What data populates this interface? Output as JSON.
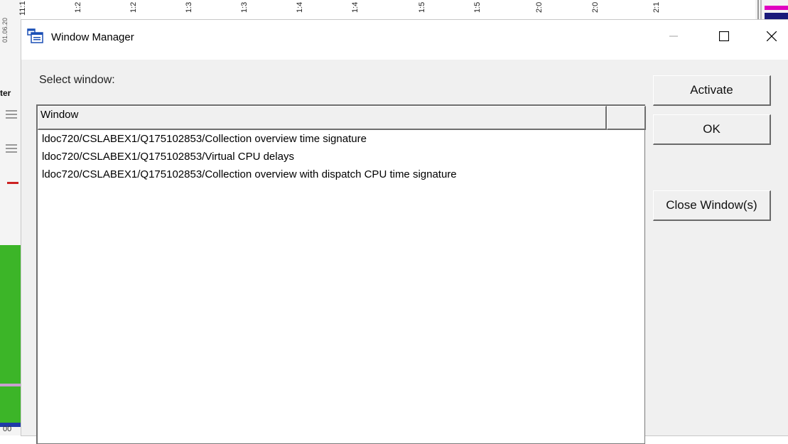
{
  "background": {
    "top_ticks": [
      "11:1",
      "1:2",
      "1:2",
      "1:3",
      "1:3",
      "1:4",
      "1:4",
      "1:5",
      "1:5",
      "2:0",
      "2:0",
      "2:1"
    ],
    "date_label": "01.06.20",
    "side_label": "ter",
    "bottom_left_label": "00"
  },
  "dialog": {
    "title": "Window Manager",
    "select_label": "Select window:",
    "list": {
      "column_header": "Window",
      "rows": [
        "ldoc720/CSLABEX1/Q175102853/Collection overview time signature",
        "ldoc720/CSLABEX1/Q175102853/Virtual CPU delays",
        "ldoc720/CSLABEX1/Q175102853/Collection overview with dispatch CPU time signature"
      ]
    },
    "buttons": {
      "activate": "Activate",
      "ok": "OK",
      "close_windows": "Close Window(s)"
    }
  },
  "icons": {
    "app": "window-manager-icon",
    "minimize": "minimize-icon",
    "maximize": "maximize-icon",
    "close": "close-icon"
  }
}
